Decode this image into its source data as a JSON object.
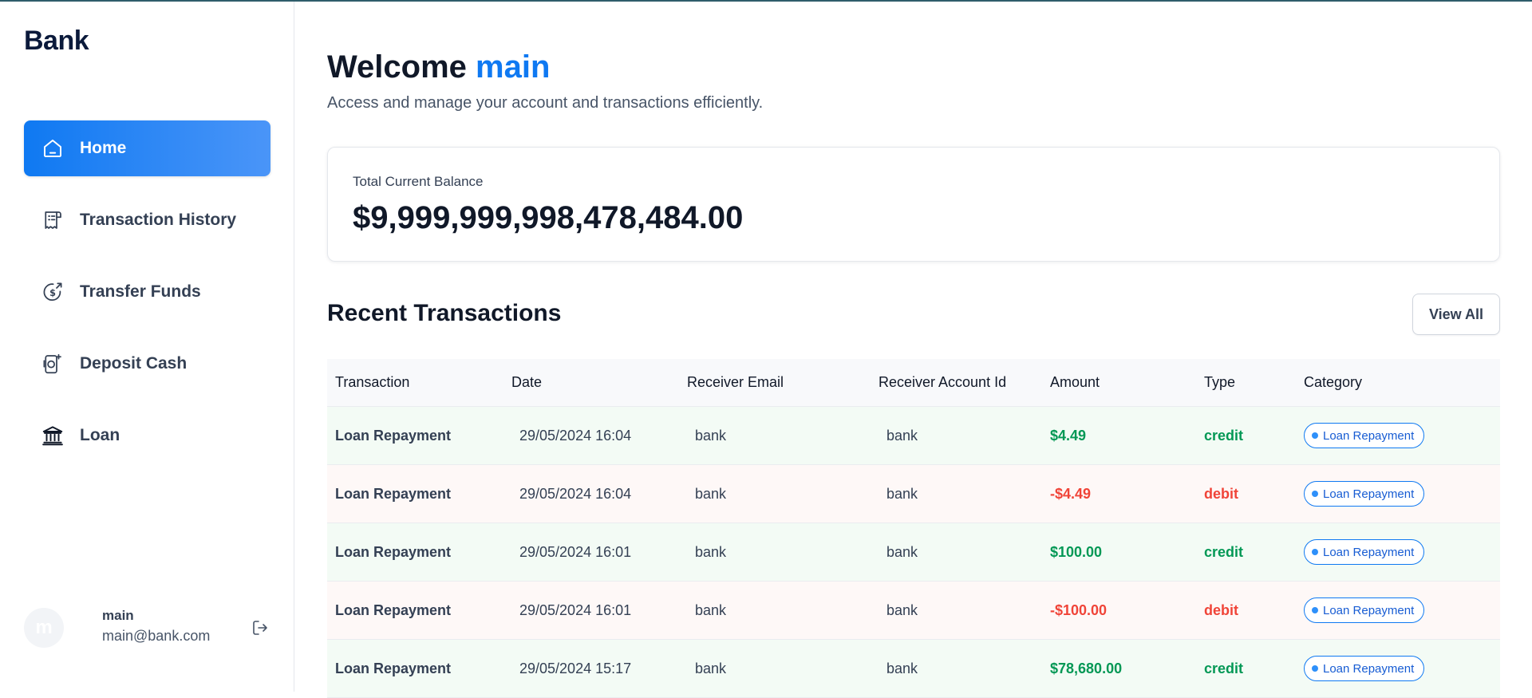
{
  "brand": "Bank",
  "nav": [
    {
      "label": "Home",
      "icon": "home-icon",
      "active": true
    },
    {
      "label": "Transaction History",
      "icon": "receipt-icon",
      "active": false
    },
    {
      "label": "Transfer Funds",
      "icon": "dollar-transfer-icon",
      "active": false
    },
    {
      "label": "Deposit Cash",
      "icon": "deposit-icon",
      "active": false
    },
    {
      "label": "Loan",
      "icon": "bank-building-icon",
      "active": false
    }
  ],
  "user": {
    "initial": "m",
    "name": "main",
    "email": "main@bank.com"
  },
  "header": {
    "welcome": "Welcome",
    "username": "main",
    "subtitle": "Access and manage your account and transactions efficiently."
  },
  "balance": {
    "label": "Total Current Balance",
    "amount": "$9,999,999,998,478,484.00"
  },
  "recent": {
    "title": "Recent Transactions",
    "view_all": "View All"
  },
  "table": {
    "columns": [
      "Transaction",
      "Date",
      "Receiver Email",
      "Receiver Account Id",
      "Amount",
      "Type",
      "Category"
    ],
    "rows": [
      {
        "transaction": "Loan Repayment",
        "date": "29/05/2024 16:04",
        "email": "bank",
        "account": "bank",
        "amount": "$4.49",
        "type": "credit",
        "category": "Loan Repayment"
      },
      {
        "transaction": "Loan Repayment",
        "date": "29/05/2024 16:04",
        "email": "bank",
        "account": "bank",
        "amount": "-$4.49",
        "type": "debit",
        "category": "Loan Repayment"
      },
      {
        "transaction": "Loan Repayment",
        "date": "29/05/2024 16:01",
        "email": "bank",
        "account": "bank",
        "amount": "$100.00",
        "type": "credit",
        "category": "Loan Repayment"
      },
      {
        "transaction": "Loan Repayment",
        "date": "29/05/2024 16:01",
        "email": "bank",
        "account": "bank",
        "amount": "-$100.00",
        "type": "debit",
        "category": "Loan Repayment"
      },
      {
        "transaction": "Loan Repayment",
        "date": "29/05/2024 15:17",
        "email": "bank",
        "account": "bank",
        "amount": "$78,680.00",
        "type": "credit",
        "category": "Loan Repayment"
      }
    ]
  },
  "colors": {
    "accent": "#0f79f2",
    "credit": "#039855",
    "debit": "#f04438"
  }
}
